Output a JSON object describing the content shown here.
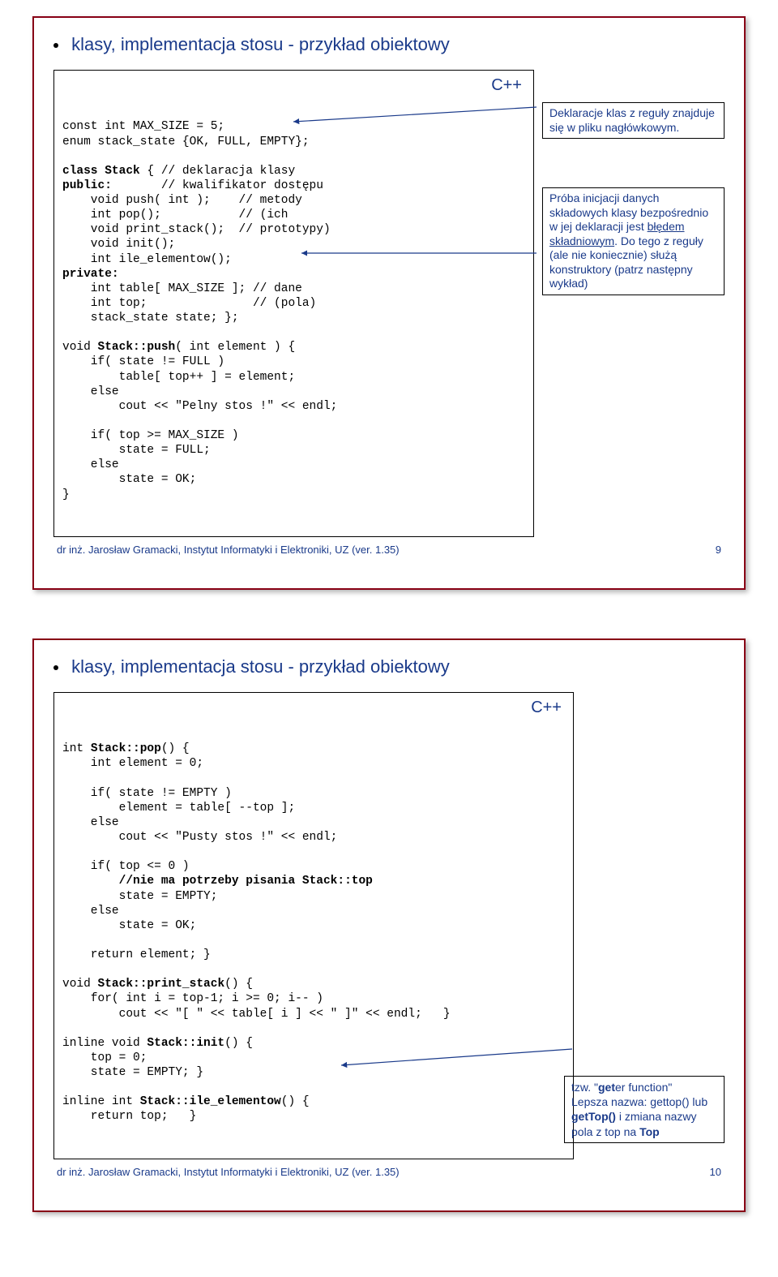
{
  "slide1": {
    "title": "klasy, implementacja stosu  - przykład obiektowy",
    "cpp": "C++",
    "code_lines": [
      "const int MAX_SIZE = 5;",
      "enum stack_state {OK, FULL, EMPTY};",
      "",
      "class Stack { // deklaracja klasy",
      "public:       // kwalifikator dostępu",
      "    void push( int );    // metody",
      "    int pop();           // (ich",
      "    void print_stack();  // prototypy)",
      "    void init();",
      "    int ile_elementow();",
      "private:",
      "    int table[ MAX_SIZE ]; // dane",
      "    int top;               // (pola)",
      "    stack_state state; };",
      "",
      "void Stack::push( int element ) {",
      "    if( state != FULL )",
      "        table[ top++ ] = element;",
      "    else",
      "        cout << \"Pelny stos !\" << endl;",
      "",
      "    if( top >= MAX_SIZE )",
      "        state = FULL;",
      "    else",
      "        state = OK;",
      "}"
    ],
    "note1": "Deklaracje klas z reguły znajduje się w pliku nagłówkowym.",
    "note2_parts": {
      "p1": "Próba inicjacji danych składowych klasy bezpośrednio w jej deklaracji jest ",
      "u1": "błędem składniowym",
      "p2": ". Do tego z reguły (ale nie koniecznie) służą konstruktory (patrz następny wykład)"
    },
    "footer_left": "dr inż. Jarosław Gramacki, Instytut Informatyki i Elektroniki, UZ (ver. 1.35)",
    "footer_right": "9"
  },
  "slide2": {
    "title": "klasy, implementacja stosu  - przykład obiektowy",
    "cpp": "C++",
    "code_lines": [
      "int Stack::pop() {",
      "    int element = 0;",
      "",
      "    if( state != EMPTY )",
      "        element = table[ --top ];",
      "    else",
      "        cout << \"Pusty stos !\" << endl;",
      "",
      "    if( top <= 0 )",
      "        //nie ma potrzeby pisania Stack::top",
      "        state = EMPTY;",
      "    else",
      "        state = OK;",
      "",
      "    return element; }",
      "",
      "void Stack::print_stack() {",
      "    for( int i = top-1; i >= 0; i-- )",
      "        cout << \"[ \" << table[ i ] << \" ]\" << endl;   }",
      "",
      "inline void Stack::init() {",
      "    top = 0;",
      "    state = EMPTY; }",
      "",
      "inline int Stack::ile_elementow() {",
      "    return top;   }"
    ],
    "note_parts": {
      "p1": "tzw. \"",
      "b1": "get",
      "p2": "er function\"\nLepsza nazwa: gettop() lub ",
      "b2": "getTop()",
      "p3": " i zmiana nazwy pola z top na ",
      "b3": "Top"
    },
    "footer_left": "dr inż. Jarosław Gramacki, Instytut Informatyki i Elektroniki, UZ (ver. 1.35)",
    "footer_right": "10"
  }
}
